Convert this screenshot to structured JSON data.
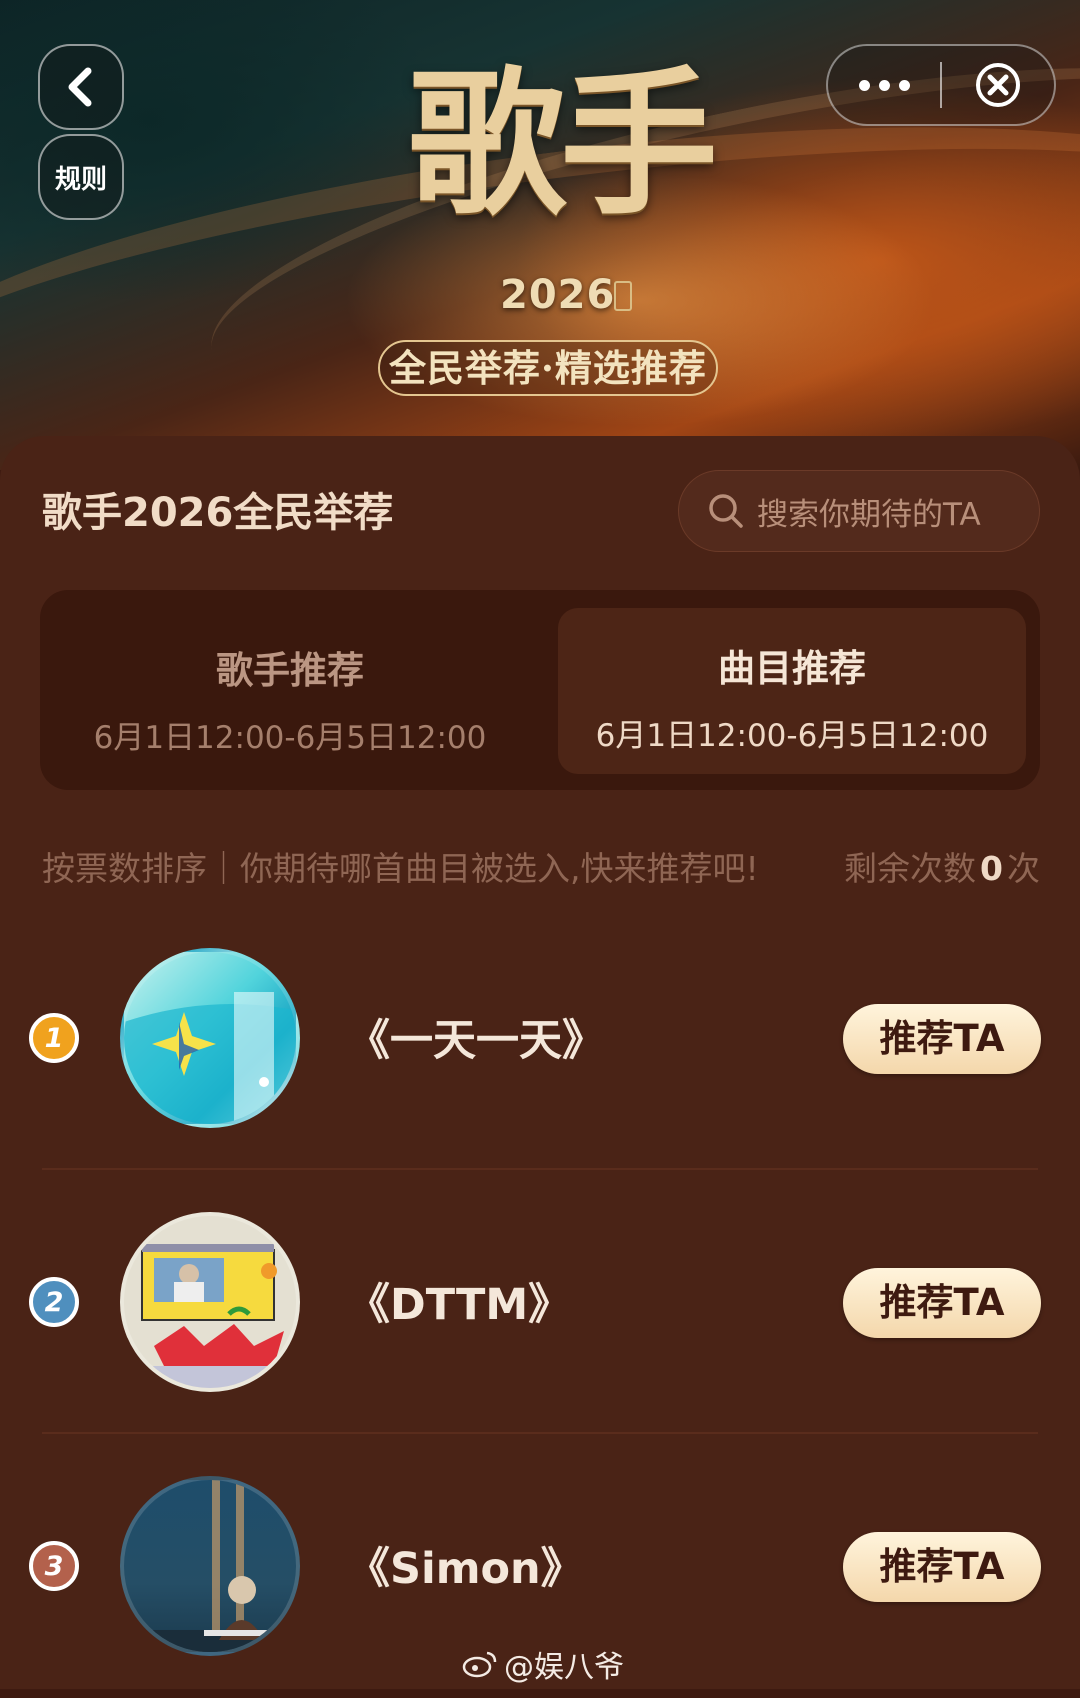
{
  "header": {
    "rules_label": "规则",
    "logo_title": "歌手",
    "logo_year": "2026",
    "logo_subtitle": "全民举荐·精选推荐",
    "back_icon": "chevron-left-icon",
    "more_icon": "more-dots-icon",
    "close_icon": "close-circle-icon"
  },
  "main": {
    "title": "歌手2026全民举荐",
    "search_placeholder": "搜索你期待的TA"
  },
  "tabs": [
    {
      "name": "歌手推荐",
      "time": "6月1日12:00-6月5日12:00",
      "active": false
    },
    {
      "name": "曲目推荐",
      "time": "6月1日12:00-6月5日12:00",
      "active": true
    }
  ],
  "info": {
    "sort_text": "按票数排序｜你期待哪首曲目被选入,快来推荐吧!",
    "remaining_prefix": "剩余次数",
    "remaining_count": "0",
    "remaining_suffix": "次"
  },
  "songs": [
    {
      "rank": "1",
      "title": "《一天一天》",
      "button_label": "推荐TA",
      "rank_color": "#f0a21e"
    },
    {
      "rank": "2",
      "title": "《DTTM》",
      "button_label": "推荐TA",
      "rank_color": "#4f8fbe"
    },
    {
      "rank": "3",
      "title": "《Simon》",
      "button_label": "推荐TA",
      "rank_color": "#b3614c"
    }
  ],
  "watermark": {
    "text": "@娱八爷",
    "icon": "weibo-icon"
  },
  "colors": {
    "panel_bg": "#4a2316",
    "button_gradient_top": "#fff4dc",
    "button_gradient_bottom": "#f4d7ab"
  }
}
